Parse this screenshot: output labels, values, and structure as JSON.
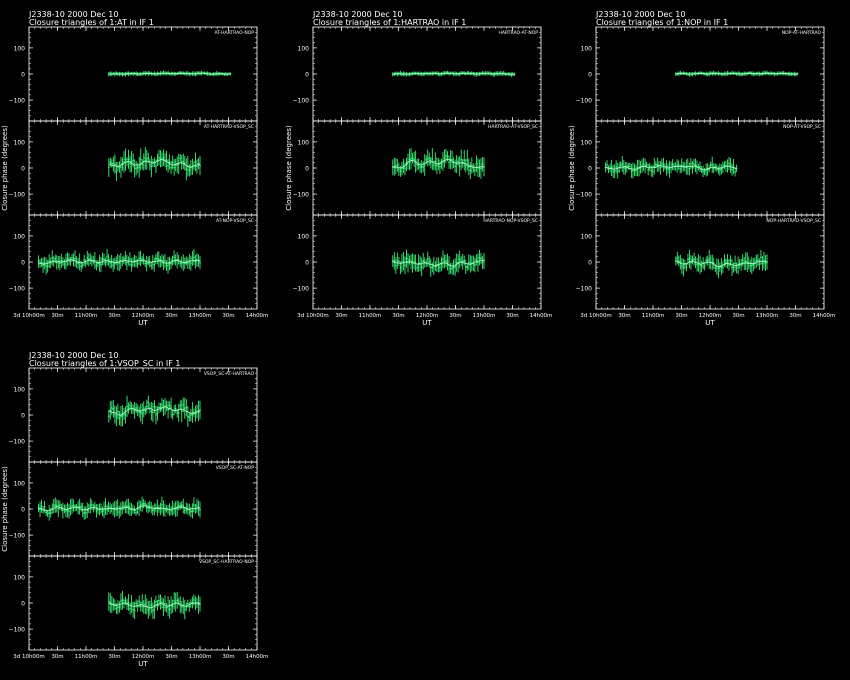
{
  "figure": {
    "background": "#000000",
    "fg": "#ffffff",
    "accent": "#3cf07a"
  },
  "chart_data": [
    {
      "type": "line",
      "title": "J2338-10  2000 Dec 10",
      "subtitle": "Closure triangles of 1:AT in IF 1",
      "xlabel": "UT",
      "ylabel": "Closure phase   (degrees)",
      "xticks": [
        "3d 10h00m",
        "30m",
        "11h00m",
        "30m",
        "12h00m",
        "30m",
        "13h00m",
        "30m",
        "14h00m"
      ],
      "xlim": [
        0,
        240
      ],
      "ylim": [
        -180,
        180
      ],
      "yticks": [
        -100,
        0,
        100
      ],
      "panels": [
        {
          "name": "AT-HARTRAO-NOP",
          "x_start": 84,
          "x_end": 212,
          "spread": 4,
          "trend": 2
        },
        {
          "name": "AT-HARTRAO-VSOP_SC",
          "x_start": 84,
          "x_end": 180,
          "spread": 30,
          "trend": 25
        },
        {
          "name": "AT-NOP-VSOP_SC",
          "x_start": 10,
          "x_end": 180,
          "spread": 22,
          "trend": 3
        }
      ]
    },
    {
      "type": "line",
      "title": "J2338-10  2000 Dec 10",
      "subtitle": "Closure triangles of 1:HARTRAO in IF 1",
      "xlabel": "UT",
      "ylabel": "Closure phase   (degrees)",
      "xticks": [
        "3d 10h00m",
        "30m",
        "11h00m",
        "30m",
        "12h00m",
        "30m",
        "13h00m",
        "30m",
        "14h00m"
      ],
      "xlim": [
        0,
        240
      ],
      "ylim": [
        -180,
        180
      ],
      "yticks": [
        -100,
        0,
        100
      ],
      "panels": [
        {
          "name": "HARTRAO-AT-NOP",
          "x_start": 84,
          "x_end": 212,
          "spread": 4,
          "trend": 2
        },
        {
          "name": "HARTRAO-AT-VSOP_SC",
          "x_start": 84,
          "x_end": 180,
          "spread": 30,
          "trend": 25
        },
        {
          "name": "HARTRAO-NOP-VSOP_SC",
          "x_start": 84,
          "x_end": 180,
          "spread": 26,
          "trend": -10
        }
      ]
    },
    {
      "type": "line",
      "title": "J2338-10  2000 Dec 10",
      "subtitle": "Closure triangles of 1:NOP in IF 1",
      "xlabel": "UT",
      "ylabel": "Closure phase   (degrees)",
      "xticks": [
        "3d 10h00m",
        "30m",
        "11h00m",
        "30m",
        "12h00m",
        "30m",
        "13h00m",
        "30m",
        "14h00m"
      ],
      "xlim": [
        0,
        240
      ],
      "ylim": [
        -180,
        180
      ],
      "yticks": [
        -100,
        0,
        100
      ],
      "panels": [
        {
          "name": "NOP-AT-HARTRAO",
          "x_start": 84,
          "x_end": 212,
          "spread": 4,
          "trend": 2
        },
        {
          "name": "NOP-AT-VSOP_SC",
          "x_start": 10,
          "x_end": 148,
          "spread": 22,
          "trend": 3
        },
        {
          "name": "NOP-HARTRAO-VSOP_SC",
          "x_start": 84,
          "x_end": 180,
          "spread": 26,
          "trend": -10
        }
      ]
    },
    {
      "type": "line",
      "title": "J2338-10  2000 Dec 10",
      "subtitle": "Closure triangles of 1:VSOP_SC in IF 1",
      "xlabel": "UT",
      "ylabel": "Closure phase   (degrees)",
      "xticks": [
        "3d 10h00m",
        "30m",
        "11h00m",
        "30m",
        "12h00m",
        "30m",
        "13h00m",
        "30m",
        "14h00m"
      ],
      "xlim": [
        0,
        240
      ],
      "ylim": [
        -180,
        180
      ],
      "yticks": [
        -100,
        0,
        100
      ],
      "panels": [
        {
          "name": "VSOP_SC-AT-HARTRAO",
          "x_start": 84,
          "x_end": 180,
          "spread": 30,
          "trend": 25
        },
        {
          "name": "VSOP_SC-AT-NOP",
          "x_start": 10,
          "x_end": 180,
          "spread": 22,
          "trend": 3
        },
        {
          "name": "VSOP_SC-HARTRAO-NOP",
          "x_start": 84,
          "x_end": 180,
          "spread": 26,
          "trend": -10
        }
      ]
    }
  ]
}
